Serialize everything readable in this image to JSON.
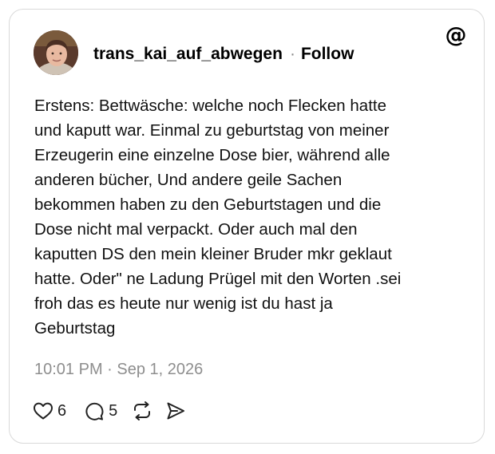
{
  "post": {
    "username": "trans_kai_auf_abwegen",
    "separator": "·",
    "follow_label": "Follow",
    "text": "Erstens: Bettwäsche: welche noch Flecken hatte\nund kaputt war. Einmal zu geburtstag von meiner\nErzeugerin eine einzelne Dose bier, während alle\nanderen bücher, Und andere geile Sachen\nbekommen haben zu den Geburtstagen und die\nDose nicht mal verpackt.  Oder auch mal den\nkaputten DS den mein kleiner Bruder mkr geklaut\nhatte. Oder\" ne Ladung Prügel mit den Worten .sei\nfroh das es heute nur wenig ist du hast ja\nGeburtstag",
    "timestamp": "10:01 PM · Sep 1, 2026",
    "likes": "6",
    "replies": "5"
  },
  "icons": {
    "brand": "threads-logo-icon",
    "like": "heart-icon",
    "reply": "speech-bubble-icon",
    "repost": "repost-icon",
    "share": "send-icon"
  },
  "colors": {
    "border": "#d9d9d9",
    "text": "#111111",
    "muted": "#8e8e8e"
  }
}
